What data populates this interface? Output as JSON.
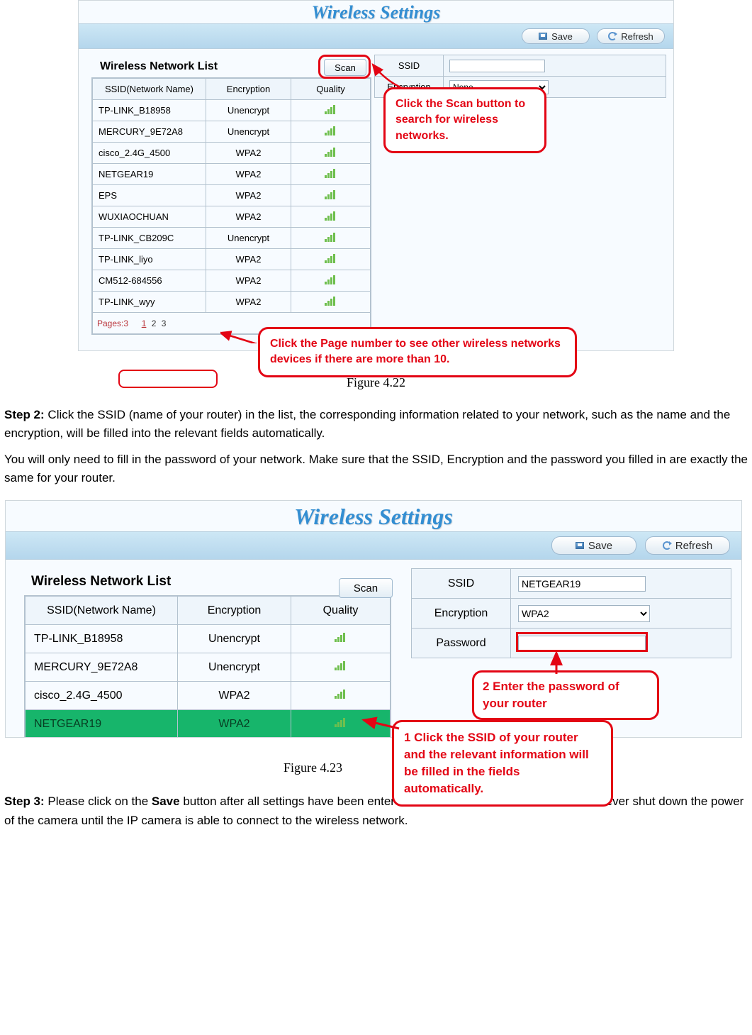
{
  "common": {
    "title": "Wireless Settings",
    "save_label": "Save",
    "refresh_label": "Refresh",
    "scan_label": "Scan",
    "list_title": "Wireless Network List",
    "col_ssid": "SSID(Network Name)",
    "col_enc": "Encryption",
    "col_qual": "Quality",
    "form_ssid": "SSID",
    "form_enc": "Encryption",
    "form_pw": "Password"
  },
  "shot1": {
    "rows": [
      {
        "ssid": "TP-LINK_B18958",
        "enc": "Unencrypt"
      },
      {
        "ssid": "MERCURY_9E72A8",
        "enc": "Unencrypt"
      },
      {
        "ssid": "cisco_2.4G_4500",
        "enc": "WPA2"
      },
      {
        "ssid": "NETGEAR19",
        "enc": "WPA2"
      },
      {
        "ssid": "EPS",
        "enc": "WPA2"
      },
      {
        "ssid": "WUXIAOCHUAN",
        "enc": "WPA2"
      },
      {
        "ssid": "TP-LINK_CB209C",
        "enc": "Unencrypt"
      },
      {
        "ssid": "TP-LINK_liyo",
        "enc": "WPA2"
      },
      {
        "ssid": "CM512-684556",
        "enc": "WPA2"
      },
      {
        "ssid": "TP-LINK_wyy",
        "enc": "WPA2"
      }
    ],
    "pages_label": "Pages:3",
    "page_links": [
      "1",
      "2",
      "3"
    ],
    "enc_option": "None",
    "callout_scan": "Click the Scan button to search for wireless networks.",
    "callout_page": "Click the Page number to see other wireless networks devices if there are more than 10."
  },
  "fig422": "Figure 4.22",
  "step2": {
    "lead": "Step 2:",
    "p1": " Click the SSID (name of your router) in the list, the corresponding information related to your network, such as the name and the encryption, will be filled into the relevant fields automatically.",
    "p2": "You will only need to fill in the password of your network. Make sure that the SSID, Encryption and the password you filled in are exactly the same for your router."
  },
  "shot2": {
    "rows": [
      {
        "ssid": "TP-LINK_B18958",
        "enc": "Unencrypt"
      },
      {
        "ssid": "MERCURY_9E72A8",
        "enc": "Unencrypt"
      },
      {
        "ssid": "cisco_2.4G_4500",
        "enc": "WPA2"
      },
      {
        "ssid": "NETGEAR19",
        "enc": "WPA2"
      }
    ],
    "ssid_value": "NETGEAR19",
    "enc_option": "WPA2",
    "callout_ssid": "1 Click the SSID of your router and the relevant information will be filled in the fields automatically.",
    "callout_pw": "2 Enter the password of your router"
  },
  "fig423": "Figure 4.23",
  "step3": {
    "lead": "Step 3:",
    "p1": " Please click on the ",
    "save_word": "Save",
    "p2": " button after all settings have been entered and disconnect the network cable. Never shut down the power of the camera until the IP camera is able to connect to the wireless network."
  }
}
